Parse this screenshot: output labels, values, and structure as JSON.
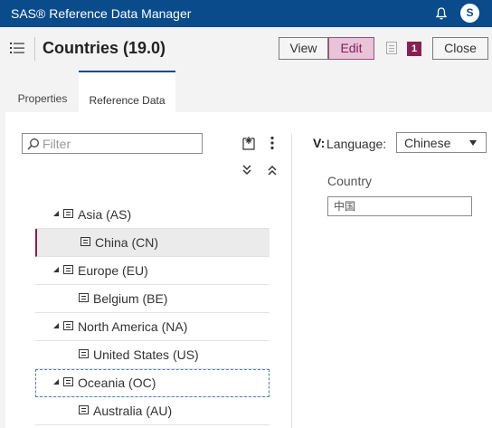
{
  "app": {
    "title": "SAS® Reference Data Manager",
    "user_initial": "S"
  },
  "header": {
    "title": "Countries (19.0)",
    "view_label": "View",
    "edit_label": "Edit",
    "badge_count": "1",
    "close_label": "Close"
  },
  "tabs": [
    {
      "label": "Properties",
      "selected": false
    },
    {
      "label": "Reference Data",
      "selected": true
    }
  ],
  "tree": {
    "filter_placeholder": "Filter",
    "items": [
      {
        "label": "Asia (AS)",
        "level": 0,
        "expanded": true
      },
      {
        "label": "China (CN)",
        "level": 1,
        "selected": true
      },
      {
        "label": "Europe (EU)",
        "level": 0,
        "expanded": true
      },
      {
        "label": "Belgium (BE)",
        "level": 1
      },
      {
        "label": "North America (NA)",
        "level": 0,
        "expanded": true
      },
      {
        "label": "United States (US)",
        "level": 1
      },
      {
        "label": "Oceania (OC)",
        "level": 0,
        "expanded": true,
        "focused": true
      },
      {
        "label": "Australia (AU)",
        "level": 1
      }
    ]
  },
  "detail": {
    "truncated_label": "V:",
    "language_label": "Language:",
    "language_value": "Chinese",
    "field_label": "Country",
    "field_value": "中国"
  },
  "colors": {
    "appbar": "#0a4b8c",
    "edit_active": "#e9c3d8",
    "accent": "#8a1f52",
    "focus": "#4a7fb8"
  }
}
